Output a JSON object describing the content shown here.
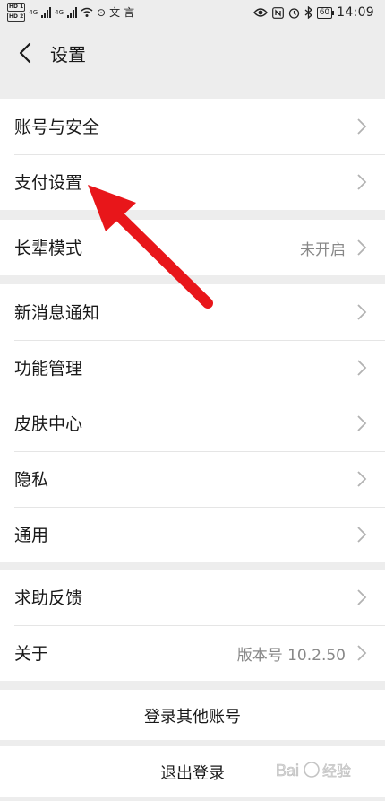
{
  "status_bar": {
    "time": "14:09",
    "battery": "60",
    "hd_badges": [
      "HD 1",
      "HD 2"
    ],
    "network": [
      "4G",
      "4G"
    ],
    "left_glyphs": [
      "⊙",
      "文",
      "言"
    ],
    "right_icons": [
      "eye-icon",
      "nfc-icon",
      "alarm-icon",
      "bluetooth-icon",
      "battery-icon"
    ]
  },
  "header": {
    "title": "设置"
  },
  "groups": [
    {
      "items": [
        {
          "label": "账号与安全",
          "value": ""
        },
        {
          "label": "支付设置",
          "value": ""
        }
      ]
    },
    {
      "items": [
        {
          "label": "长辈模式",
          "value": "未开启"
        }
      ]
    },
    {
      "items": [
        {
          "label": "新消息通知",
          "value": ""
        },
        {
          "label": "功能管理",
          "value": ""
        },
        {
          "label": "皮肤中心",
          "value": ""
        },
        {
          "label": "隐私",
          "value": ""
        },
        {
          "label": "通用",
          "value": ""
        }
      ]
    },
    {
      "items": [
        {
          "label": "求助反馈",
          "value": ""
        },
        {
          "label": "关于",
          "value": "版本号 10.2.50"
        }
      ]
    }
  ],
  "actions": {
    "switch_account": "登录其他账号",
    "logout": "退出登录"
  },
  "watermark": {
    "text": "Baidu 经验"
  },
  "colors": {
    "background": "#ededed",
    "cell": "#ffffff",
    "text": "#191919",
    "secondary": "#888888",
    "annotation": "#e8161a"
  }
}
